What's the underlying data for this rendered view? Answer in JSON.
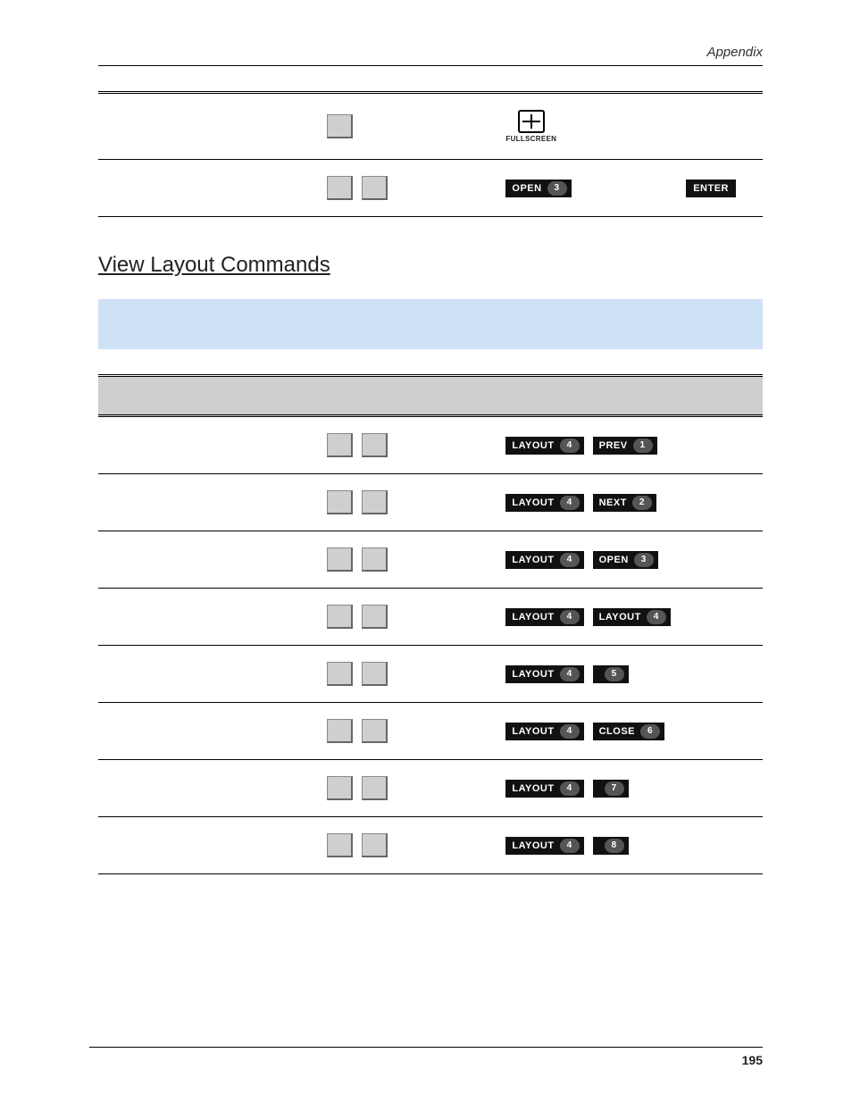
{
  "header": {
    "section": "Appendix"
  },
  "footer": {
    "page": "195"
  },
  "fullscreen_icon_label": "FULLSCREEN",
  "enter_label": "ENTER",
  "top_rows": [
    {
      "remote": [
        {
          "kind": "fullscreen"
        }
      ],
      "kb_count": 1
    },
    {
      "remote": [
        {
          "kind": "chip",
          "label": "OPEN",
          "num": "3"
        },
        {
          "kind": "enter"
        }
      ],
      "kb_count": 2
    }
  ],
  "section_title": "View Layout Commands",
  "table_headers": {
    "c1": "",
    "c2": "",
    "c3": ""
  },
  "layout_rows": [
    {
      "kb_count": 2,
      "remote": [
        {
          "label": "LAYOUT",
          "num": "4"
        },
        {
          "label": "PREV",
          "num": "1"
        }
      ]
    },
    {
      "kb_count": 2,
      "remote": [
        {
          "label": "LAYOUT",
          "num": "4"
        },
        {
          "label": "NEXT",
          "num": "2"
        }
      ]
    },
    {
      "kb_count": 2,
      "remote": [
        {
          "label": "LAYOUT",
          "num": "4"
        },
        {
          "label": "OPEN",
          "num": "3"
        }
      ]
    },
    {
      "kb_count": 2,
      "remote": [
        {
          "label": "LAYOUT",
          "num": "4"
        },
        {
          "label": "LAYOUT",
          "num": "4"
        }
      ]
    },
    {
      "kb_count": 2,
      "remote": [
        {
          "label": "LAYOUT",
          "num": "4"
        },
        {
          "label": "",
          "num": "5"
        }
      ]
    },
    {
      "kb_count": 2,
      "remote": [
        {
          "label": "LAYOUT",
          "num": "4"
        },
        {
          "label": "CLOSE",
          "num": "6"
        }
      ]
    },
    {
      "kb_count": 2,
      "remote": [
        {
          "label": "LAYOUT",
          "num": "4"
        },
        {
          "label": "",
          "num": "7"
        }
      ]
    },
    {
      "kb_count": 2,
      "remote": [
        {
          "label": "LAYOUT",
          "num": "4"
        },
        {
          "label": "",
          "num": "8"
        }
      ]
    }
  ]
}
